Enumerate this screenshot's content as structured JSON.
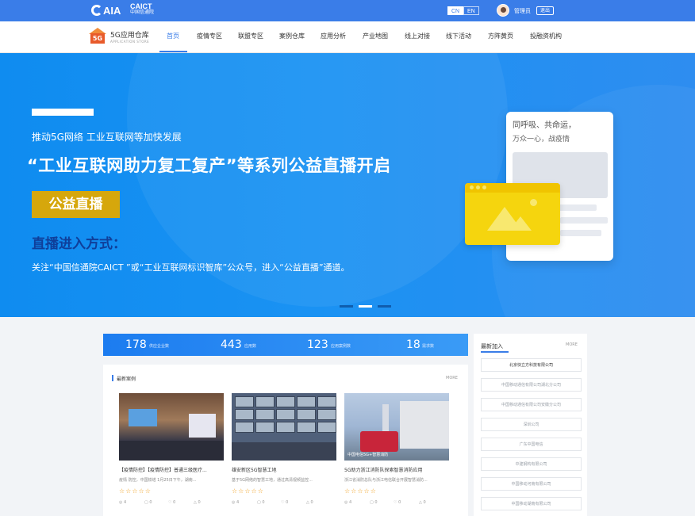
{
  "topbar": {
    "logo_aia": "AIA",
    "logo_caict": "CAICT",
    "logo_caict_sub": "中国信通院",
    "lang_cn": "CN",
    "lang_en": "EN",
    "username": "管理员",
    "logout": "退出"
  },
  "brand": {
    "icon_text": "5G",
    "title": "5G应用仓库",
    "subtitle": "APPLICATION STORE"
  },
  "nav": {
    "items": [
      {
        "label": "首页"
      },
      {
        "label": "疫情专区"
      },
      {
        "label": "联盟专区"
      },
      {
        "label": "案例仓库"
      },
      {
        "label": "应用分析"
      },
      {
        "label": "产业地图"
      },
      {
        "label": "线上对接"
      },
      {
        "label": "线下活动"
      },
      {
        "label": "方阵黄页"
      },
      {
        "label": "投融资机构"
      }
    ],
    "active_index": 0
  },
  "banner": {
    "subtitle": "推动5G网络 工业互联网等加快发展",
    "title": "“工业互联网助力复工复产”等系列公益直播开启",
    "badge": "公益直播",
    "access_heading": "直播进入方式：",
    "access_desc": "关注“中国信通院CAICT ”或“工业互联网标识智库”公众号，进入“公益直播”通道。",
    "card_line1": "同呼吸、共命运，",
    "card_line2": "万众一心，战疫情",
    "slides_total": 3,
    "active_slide": 2
  },
  "stats": [
    {
      "value": "178",
      "label": "供应企业数"
    },
    {
      "value": "443",
      "label": "应用数"
    },
    {
      "value": "123",
      "label": "应用案例数"
    },
    {
      "value": "18",
      "label": "需求数"
    }
  ],
  "cases": {
    "title": "最新案例",
    "more": "MORE",
    "items": [
      {
        "title": "【疫情防控】【疫情防控】普通三级医疗...",
        "desc": "疫情 防控，中国铁塔 1月25日下午，湖南...",
        "stars": "☆☆☆☆☆",
        "meta": [
          "4",
          "0",
          "0",
          "0"
        ]
      },
      {
        "title": "雄安新区5G智慧工地",
        "desc": "基于5G网络的智慧工地，通过高清视频监控...",
        "stars": "☆☆☆☆☆",
        "meta": [
          "4",
          "0",
          "0",
          "0"
        ]
      },
      {
        "title": "5G助力浙江消防队探索智慧消防应用",
        "desc": "浙江省消防总队与浙江电信联合开展智慧消防...",
        "stars": "☆☆☆☆☆",
        "meta": [
          "4",
          "0",
          "0",
          "0"
        ],
        "image_caption": "中国电信5G+智慧消防"
      }
    ]
  },
  "latest": {
    "title": "最新加入",
    "more": "MORE",
    "companies": [
      "北京快立方科技有限公司",
      "中国移动通信有限公司湖北分公司",
      "中国移动通信有限公司安徽分公司",
      "深圳公司",
      "广东中国电信",
      "中建钢构有限公司",
      "中国移动河南有限公司",
      "中国移动湖南有限公司"
    ]
  },
  "colors": {
    "primary": "#3a7de8",
    "banner_blue": "#1a92f3",
    "gold": "#d6a70c",
    "navy": "#0f3f9a"
  }
}
